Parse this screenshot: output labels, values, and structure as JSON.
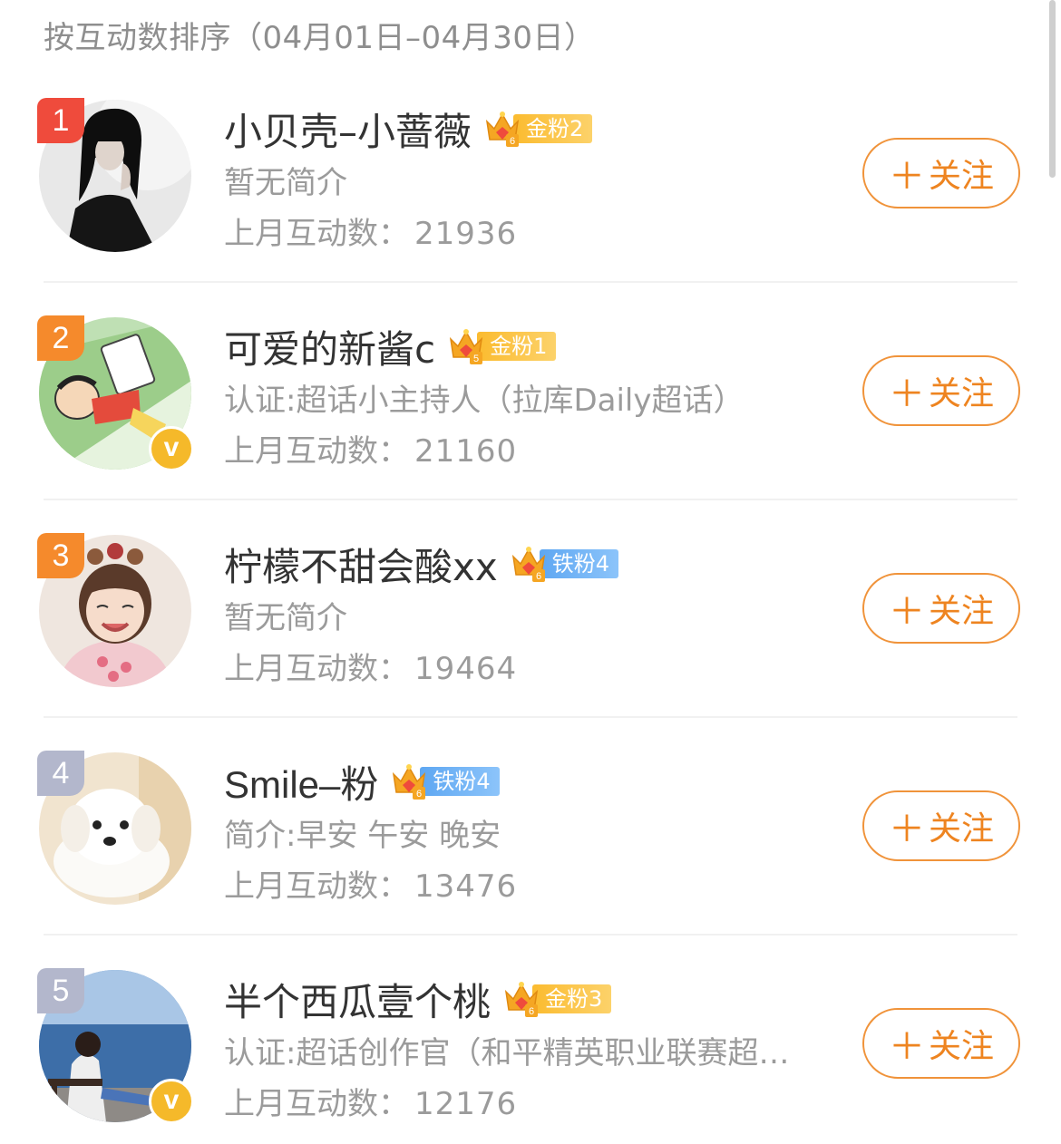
{
  "header": {
    "title": "按互动数排序（04月01日–04月30日）"
  },
  "colors": {
    "follow_orange": "#ee8420",
    "rank_red": "#ef4b3c",
    "rank_orange": "#f58a2c",
    "rank_gray": "#b3b7cc",
    "gold_badge": "#fbbb2f",
    "iron_badge": "#5ea7f2",
    "verified_yellow": "#f5b92a"
  },
  "count_label": "上月互动数：",
  "follow_label": "关注",
  "follow_icon": "plus-icon",
  "users": [
    {
      "rank": "1",
      "name": "小贝壳–小蔷薇",
      "badge_text": "金粉2",
      "badge_type": "gold",
      "desc": "暂无简介",
      "count": "21936",
      "verified": false,
      "avatar_icon": "avatar-woman-black-hair"
    },
    {
      "rank": "2",
      "name": "可爱的新酱c",
      "badge_text": "金粉1",
      "badge_type": "gold",
      "desc": "认证:超话小主持人（拉库Daily超话）",
      "count": "21160",
      "verified": true,
      "avatar_icon": "avatar-cartoon-boy"
    },
    {
      "rank": "3",
      "name": "柠檬不甜会酸xx",
      "badge_text": "铁粉4",
      "badge_type": "iron",
      "desc": "暂无简介",
      "count": "19464",
      "verified": false,
      "avatar_icon": "avatar-little-girl"
    },
    {
      "rank": "4",
      "name": "Smile–粉",
      "badge_text": "铁粉4",
      "badge_type": "iron",
      "desc": "简介:早安 午安 晚安",
      "count": "13476",
      "verified": false,
      "avatar_icon": "avatar-white-puppy"
    },
    {
      "rank": "5",
      "name": "半个西瓜壹个桃",
      "badge_text": "金粉3",
      "badge_type": "gold",
      "desc": "认证:超话创作官（和平精英职业联赛超…",
      "count": "12176",
      "verified": true,
      "avatar_icon": "avatar-seaside-girl"
    }
  ]
}
